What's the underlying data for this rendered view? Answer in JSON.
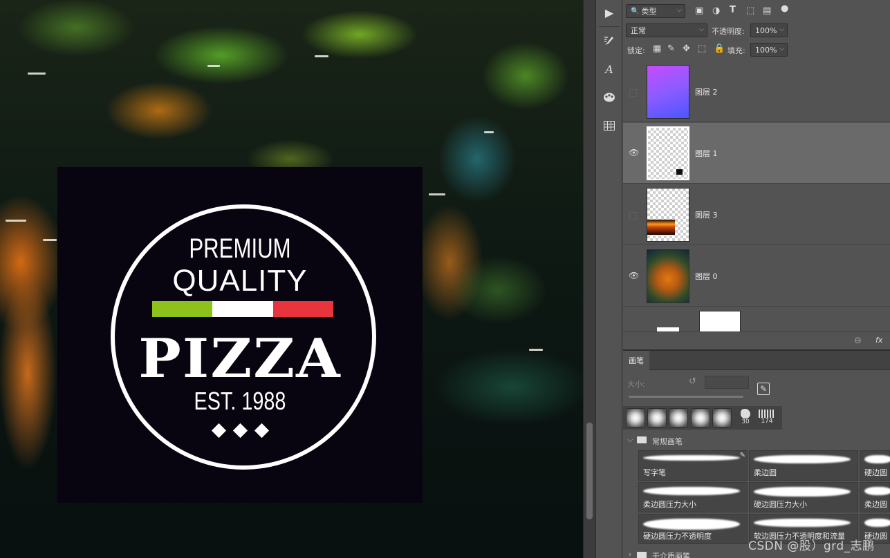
{
  "canvas": {
    "artwork": {
      "line1": "PREMIUM",
      "line2": "QUALITY",
      "line3": "PIZZA",
      "line4": "EST. 1988",
      "flag_colors": [
        "#8cc21b",
        "#ffffff",
        "#e8343c"
      ]
    }
  },
  "toolstrip": {
    "icons": [
      "play-icon",
      "brush-settings-icon",
      "character-icon",
      "palette-icon",
      "table-icon"
    ]
  },
  "layers_panel": {
    "filter_kind": "类型",
    "blend_mode": "正常",
    "opacity_label": "不透明度:",
    "opacity_value": "100%",
    "lock_label": "锁定:",
    "fill_label": "填充:",
    "fill_value": "100%",
    "layers": [
      {
        "name": "图层 2",
        "visible": false,
        "selected": false
      },
      {
        "name": "图层 1",
        "visible": true,
        "selected": true
      },
      {
        "name": "图层 3",
        "visible": false,
        "selected": false
      },
      {
        "name": "图层 0",
        "visible": true,
        "selected": false
      }
    ],
    "footer_fx": "fx"
  },
  "brush_panel": {
    "tab_label": "画笔",
    "size_label": "大小:",
    "preset_sizes": [
      "30",
      "174"
    ],
    "group_label": "常规画笔",
    "brushes": [
      "写字笔",
      "柔边圆",
      "硬边圆",
      "柔边圆压力大小",
      "硬边圆压力大小",
      "柔边圆",
      "硬边圆压力不透明度",
      "软边圆压力不透明度和流量",
      "硬边圆"
    ],
    "next_group_label": "干介质画笔"
  },
  "watermark": "CSDN @股）grd_志鹏"
}
